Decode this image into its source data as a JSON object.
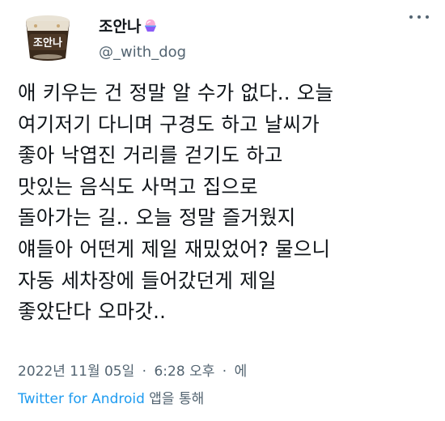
{
  "user": {
    "display_name": "조안나",
    "name_emoji_icon": "shaved-ice-icon",
    "handle": "@_with_dog",
    "avatar_text": "조안나",
    "avatar_icon": "ice-cream-tub-icon"
  },
  "more_icon": "more-horizontal-icon",
  "tweet": {
    "lines": [
      "애 키우는 건 정말 알 수가 없다.. 오늘",
      "여기저기 다니며 구경도 하고 날씨가",
      "좋아 낙엽진 거리를 걷기도 하고",
      "맛있는 음식도 사먹고 집으로",
      "돌아가는 길.. 오늘 정말 즐거웠지",
      "얘들아 어떤게 제일 재밌었어? 물으니",
      "자동 세차장에 들어갔던게 제일",
      "좋았단다 오마갓.."
    ]
  },
  "meta": {
    "date": "2022년 11월 05일",
    "sep1": "·",
    "time": "6:28 오후",
    "sep2": "·",
    "trail": "에"
  },
  "source": {
    "app": "Twitter for Android",
    "suffix": "앱을 통해"
  },
  "colors": {
    "text": "#0f1419",
    "secondary": "#536471",
    "link": "#1d9bf0"
  }
}
